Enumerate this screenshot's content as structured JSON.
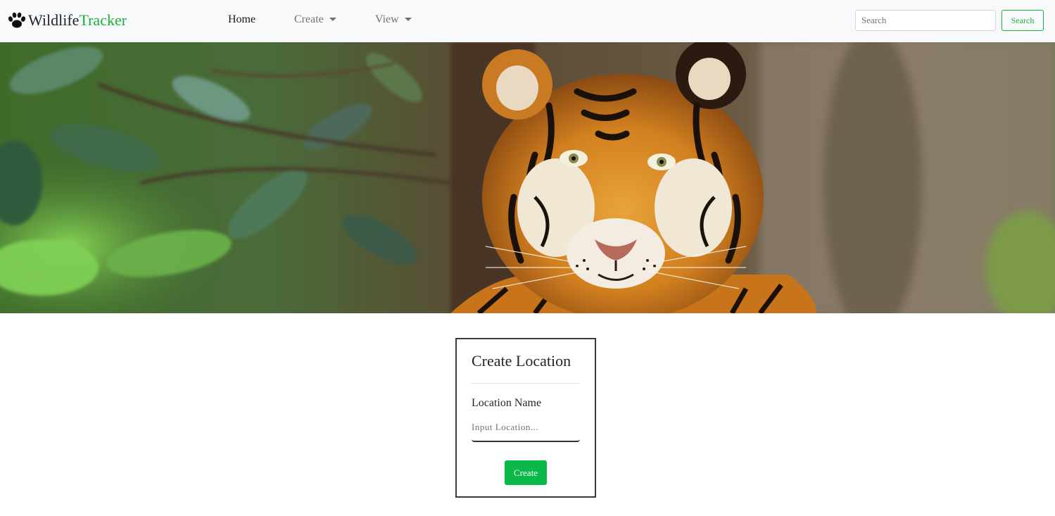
{
  "navbar": {
    "brand_part1": "Wildlife",
    "brand_part2": "Tracker",
    "brand_icon": "paw-icon",
    "links": [
      {
        "label": "Home",
        "active": true
      },
      {
        "label": "Create",
        "dropdown": true
      },
      {
        "label": "View",
        "dropdown": true
      }
    ],
    "search_placeholder": "Search",
    "search_button": "Search"
  },
  "hero": {
    "image_description_icon": "tiger-hero-image"
  },
  "form": {
    "title": "Create Location",
    "field_label": "Location Name",
    "field_placeholder": "Input Location...",
    "field_value": "",
    "submit_label": "Create"
  },
  "colors": {
    "accent_green": "#1ab13a",
    "button_green": "#0ab94a",
    "navbar_bg": "#f8f9fa"
  }
}
